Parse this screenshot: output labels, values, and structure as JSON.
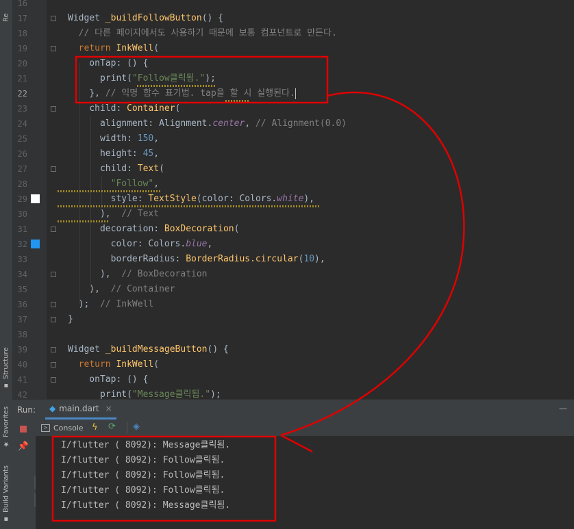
{
  "side_tabs": {
    "resource_label": "Re",
    "structure_label": "Structure",
    "favorites_label": "Favorites",
    "build_variants_label": "Build Variants"
  },
  "editor": {
    "lines": [
      {
        "n": "16",
        "tokens": []
      },
      {
        "n": "17",
        "tokens": [
          {
            "t": "Widget ",
            "c": ""
          },
          {
            "t": "_buildFollowButton",
            "c": "fn"
          },
          {
            "t": "() {",
            "c": ""
          }
        ]
      },
      {
        "n": "18",
        "tokens": [
          {
            "t": "  // 다른 페이지에서도 사용하기 때문에 보통 컴포넌트로 만든다.",
            "c": "cm"
          }
        ]
      },
      {
        "n": "19",
        "tokens": [
          {
            "t": "  ",
            "c": ""
          },
          {
            "t": "return ",
            "c": "kw"
          },
          {
            "t": "InkWell",
            "c": "cls"
          },
          {
            "t": "(",
            "c": ""
          }
        ]
      },
      {
        "n": "20",
        "tokens": [
          {
            "t": "    onTap: () {",
            "c": ""
          }
        ]
      },
      {
        "n": "21",
        "tokens": [
          {
            "t": "      print(",
            "c": ""
          },
          {
            "t": "\"Follow클릭됨.\"",
            "c": "str"
          },
          {
            "t": ");",
            "c": ""
          }
        ]
      },
      {
        "n": "22",
        "tokens": [
          {
            "t": "    }, ",
            "c": ""
          },
          {
            "t": "// 익명 함수 표기법. tap을 할 시 실행된다.",
            "c": "cm"
          }
        ],
        "current": true
      },
      {
        "n": "23",
        "tokens": [
          {
            "t": "    child: ",
            "c": ""
          },
          {
            "t": "Container",
            "c": "cls"
          },
          {
            "t": "(",
            "c": ""
          }
        ]
      },
      {
        "n": "24",
        "tokens": [
          {
            "t": "      alignment: ",
            "c": ""
          },
          {
            "t": "Alignment.",
            "c": ""
          },
          {
            "t": "center",
            "c": "it"
          },
          {
            "t": ", ",
            "c": ""
          },
          {
            "t": "// Alignment(0.0)",
            "c": "cm"
          }
        ]
      },
      {
        "n": "25",
        "tokens": [
          {
            "t": "      width: ",
            "c": ""
          },
          {
            "t": "150",
            "c": "num"
          },
          {
            "t": ",",
            "c": ""
          }
        ]
      },
      {
        "n": "26",
        "tokens": [
          {
            "t": "      height: ",
            "c": ""
          },
          {
            "t": "45",
            "c": "num"
          },
          {
            "t": ",",
            "c": ""
          }
        ]
      },
      {
        "n": "27",
        "tokens": [
          {
            "t": "      child: ",
            "c": ""
          },
          {
            "t": "Text",
            "c": "cls"
          },
          {
            "t": "(",
            "c": ""
          }
        ]
      },
      {
        "n": "28",
        "tokens": [
          {
            "t": "        ",
            "c": ""
          },
          {
            "t": "\"Follow\"",
            "c": "str"
          },
          {
            "t": ",",
            "c": ""
          }
        ]
      },
      {
        "n": "29",
        "tokens": [
          {
            "t": "        style: ",
            "c": ""
          },
          {
            "t": "TextStyle",
            "c": "cls"
          },
          {
            "t": "(color: Colors.",
            "c": ""
          },
          {
            "t": "white",
            "c": "it"
          },
          {
            "t": "),",
            "c": ""
          }
        ]
      },
      {
        "n": "30",
        "tokens": [
          {
            "t": "      ),  ",
            "c": ""
          },
          {
            "t": "// Text",
            "c": "cm"
          }
        ]
      },
      {
        "n": "31",
        "tokens": [
          {
            "t": "      decoration: ",
            "c": ""
          },
          {
            "t": "BoxDecoration",
            "c": "cls"
          },
          {
            "t": "(",
            "c": ""
          }
        ]
      },
      {
        "n": "32",
        "tokens": [
          {
            "t": "        color: Colors.",
            "c": ""
          },
          {
            "t": "blue",
            "c": "it"
          },
          {
            "t": ",",
            "c": ""
          }
        ]
      },
      {
        "n": "33",
        "tokens": [
          {
            "t": "        borderRadius: ",
            "c": ""
          },
          {
            "t": "BorderRadius.circular",
            "c": "cls"
          },
          {
            "t": "(",
            "c": ""
          },
          {
            "t": "10",
            "c": "num"
          },
          {
            "t": "),",
            "c": ""
          }
        ]
      },
      {
        "n": "34",
        "tokens": [
          {
            "t": "      ),  ",
            "c": ""
          },
          {
            "t": "// BoxDecoration",
            "c": "cm"
          }
        ]
      },
      {
        "n": "35",
        "tokens": [
          {
            "t": "    ),  ",
            "c": ""
          },
          {
            "t": "// Container",
            "c": "cm"
          }
        ]
      },
      {
        "n": "36",
        "tokens": [
          {
            "t": "  );  ",
            "c": ""
          },
          {
            "t": "// InkWell",
            "c": "cm"
          }
        ]
      },
      {
        "n": "37",
        "tokens": [
          {
            "t": "}",
            "c": ""
          }
        ]
      },
      {
        "n": "38",
        "tokens": []
      },
      {
        "n": "39",
        "tokens": [
          {
            "t": "Widget ",
            "c": ""
          },
          {
            "t": "_buildMessageButton",
            "c": "fn"
          },
          {
            "t": "() {",
            "c": ""
          }
        ]
      },
      {
        "n": "40",
        "tokens": [
          {
            "t": "  ",
            "c": ""
          },
          {
            "t": "return ",
            "c": "kw"
          },
          {
            "t": "InkWell",
            "c": "cls"
          },
          {
            "t": "(",
            "c": ""
          }
        ]
      },
      {
        "n": "41",
        "tokens": [
          {
            "t": "    onTap: () {",
            "c": ""
          }
        ]
      },
      {
        "n": "42",
        "tokens": [
          {
            "t": "      print(",
            "c": ""
          },
          {
            "t": "\"Message클릭됨.\"",
            "c": "str"
          },
          {
            "t": ");",
            "c": ""
          }
        ]
      }
    ],
    "gutter_colors": {
      "white_swatch": "#ffffff",
      "blue_swatch": "#2196f3"
    }
  },
  "run_panel": {
    "run_label": "Run:",
    "tab_label": "main.dart",
    "console_tab_label": "Console",
    "console_lines": [
      "I/flutter ( 8092): Message클릭됨.",
      "I/flutter ( 8092): Follow클릭됨.",
      "I/flutter ( 8092): Follow클릭됨.",
      "I/flutter ( 8092): Follow클릭됨.",
      "I/flutter ( 8092): Message클릭됨."
    ],
    "more_label": "»"
  },
  "annotation": {
    "color": "#e00000"
  }
}
